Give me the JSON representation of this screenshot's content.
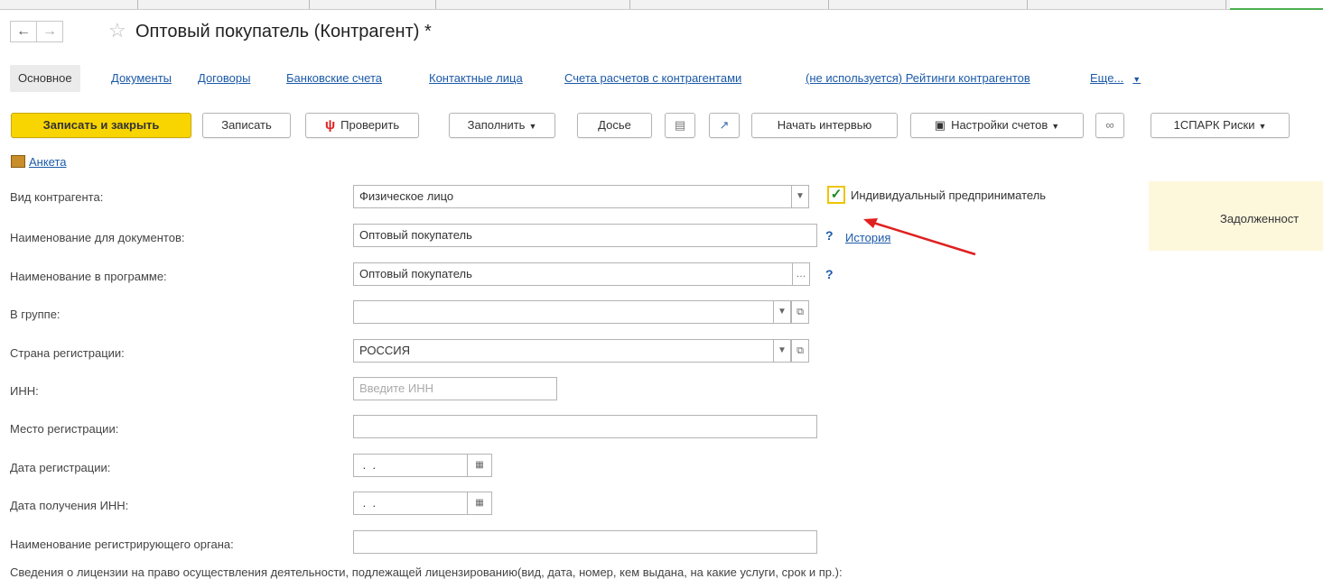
{
  "window": {
    "title": "Оптовый покупатель (Контрагент) *"
  },
  "tabs": [
    {
      "label": "Основное",
      "active": true
    },
    {
      "label": "Документы"
    },
    {
      "label": "Договоры"
    },
    {
      "label": "Банковские счета"
    },
    {
      "label": "Контактные лица"
    },
    {
      "label": "Счета расчетов с контрагентами"
    },
    {
      "label": "(не используется) Рейтинги контрагентов"
    },
    {
      "label": "Еще..."
    }
  ],
  "toolbar": {
    "save_close": "Записать и закрыть",
    "save": "Записать",
    "check": "Проверить",
    "fill": "Заполнить",
    "dossier": "Досье",
    "interview": "Начать интервью",
    "accounts_settings": "Настройки счетов",
    "spark": "1СПАРК Риски"
  },
  "anketa_link": "Анкета",
  "form": {
    "type": {
      "label": "Вид контрагента:",
      "value": "Физическое лицо"
    },
    "ip_checkbox": {
      "label": "Индивидуальный предприниматель",
      "checked": true,
      "mark": "✓"
    },
    "name_docs": {
      "label": "Наименование для документов:",
      "value": "Оптовый покупатель"
    },
    "question": "?",
    "history_link": "История",
    "name_prog": {
      "label": "Наименование в программе:",
      "value": "Оптовый покупатель"
    },
    "group": {
      "label": "В группе:",
      "value": ""
    },
    "country": {
      "label": "Страна регистрации:",
      "value": "РОССИЯ"
    },
    "inn": {
      "label": "ИНН:",
      "placeholder": "Введите ИНН"
    },
    "reg_place": {
      "label": "Место регистрации:",
      "value": ""
    },
    "reg_date": {
      "label": "Дата регистрации:",
      "value": " .  . "
    },
    "inn_date": {
      "label": "Дата получения ИНН:",
      "value": " .  . "
    },
    "reg_org": {
      "label": "Наименование регистрирующего органа:",
      "value": ""
    }
  },
  "debt_panel": {
    "text": "Задолженност"
  },
  "bottom_text": "Сведения о лицензии на право осуществления деятельности, подлежащей лицензированию(вид, дата, номер, кем выдана, на какие услуги, срок и пр.):",
  "colors": {
    "primary_button": "#f8d500",
    "link": "#1c5aa8",
    "annotation_arrow": "#e02020",
    "debt_panel": "#fdf7dc"
  }
}
